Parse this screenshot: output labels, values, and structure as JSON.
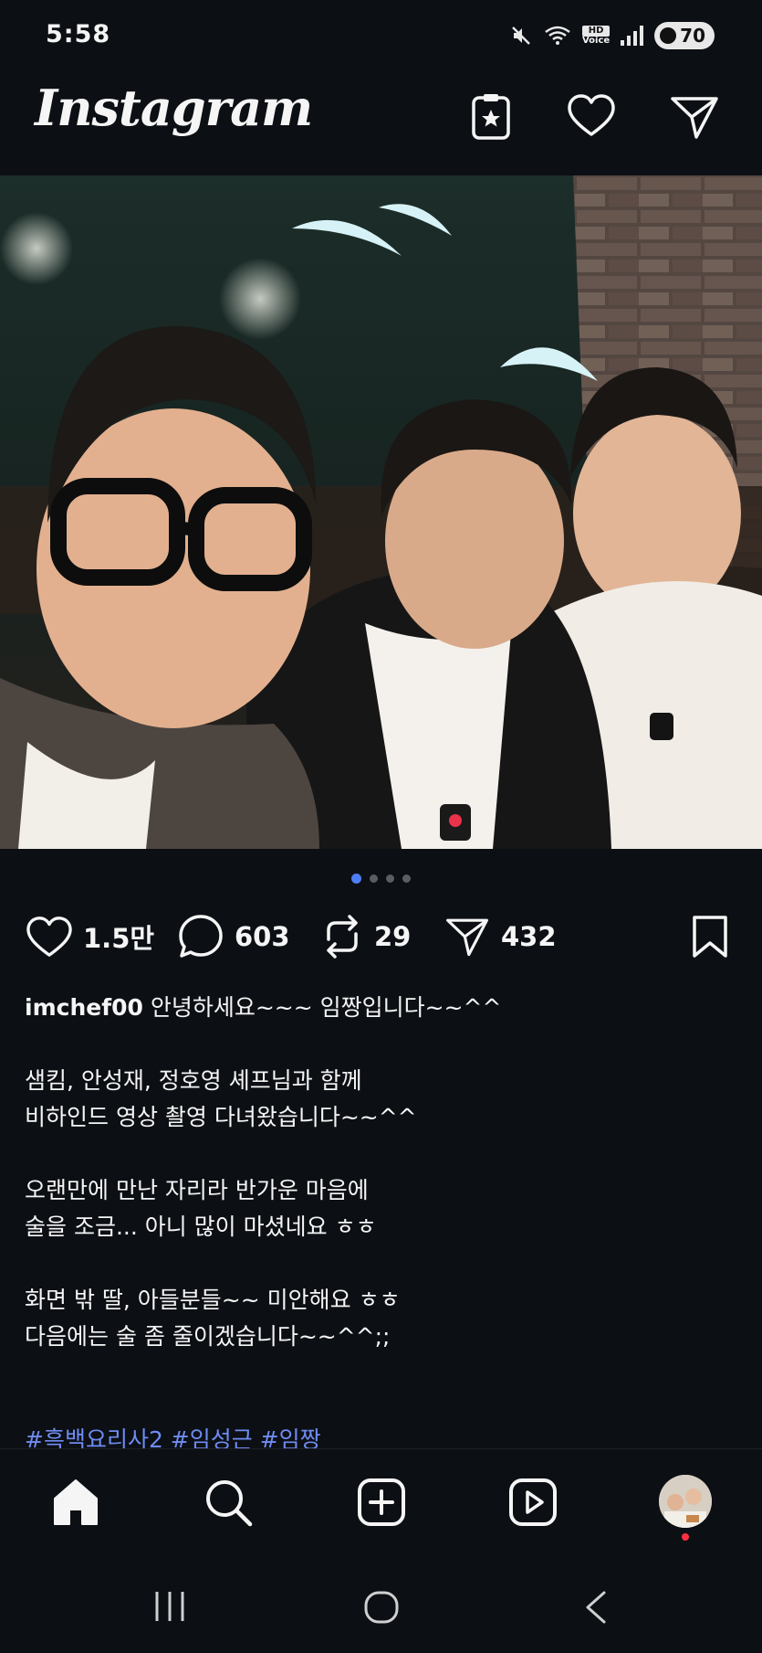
{
  "status_bar": {
    "time": "5:58",
    "battery": "70",
    "hd_top": "HD",
    "hd_bottom": "Voice",
    "icons": [
      "mute-icon",
      "wifi-icon",
      "hd-voice-icon",
      "signal-icon",
      "battery-icon"
    ]
  },
  "app_bar": {
    "logo": "Instagram",
    "icons": [
      "favorites-icon",
      "heart-icon",
      "send-icon"
    ]
  },
  "post": {
    "carousel": {
      "total": 4,
      "current": 1
    },
    "likes": "1.5만",
    "comments": "603",
    "reposts": "29",
    "shares": "432",
    "username": "imchef00",
    "caption_lines": [
      [
        "안녕하세요~~~ 임짱입니다~~^^"
      ],
      [
        "샘킴, 안성재, 정호영 셰프님과 함께",
        "비하인드 영상 촬영 다녀왔습니다~~^^"
      ],
      [
        "오랜만에 만난 자리라 반가운 마음에",
        "술을 조금... 아니 많이 마셨네요 ㅎㅎ"
      ],
      [
        "화면 밖 딸, 아들분들~~ 미안해요 ㅎㅎ",
        "다음에는 술 좀 줄이겠습니다~~^^;;"
      ]
    ],
    "hashtags": "#흑백요리사2 #임성근 #임짱"
  },
  "bottom_nav": {
    "items": [
      "home-icon",
      "search-icon",
      "create-icon",
      "reels-icon",
      "profile-avatar"
    ],
    "active": "home-icon"
  },
  "system_nav": [
    "recents-icon",
    "home-button-icon",
    "back-icon"
  ],
  "colors": {
    "background": "#0c0f14",
    "text": "#f5f5f5",
    "hashtag": "#6f8cf2",
    "active_dot": "#4f7df5",
    "notification": "#ff3040"
  }
}
